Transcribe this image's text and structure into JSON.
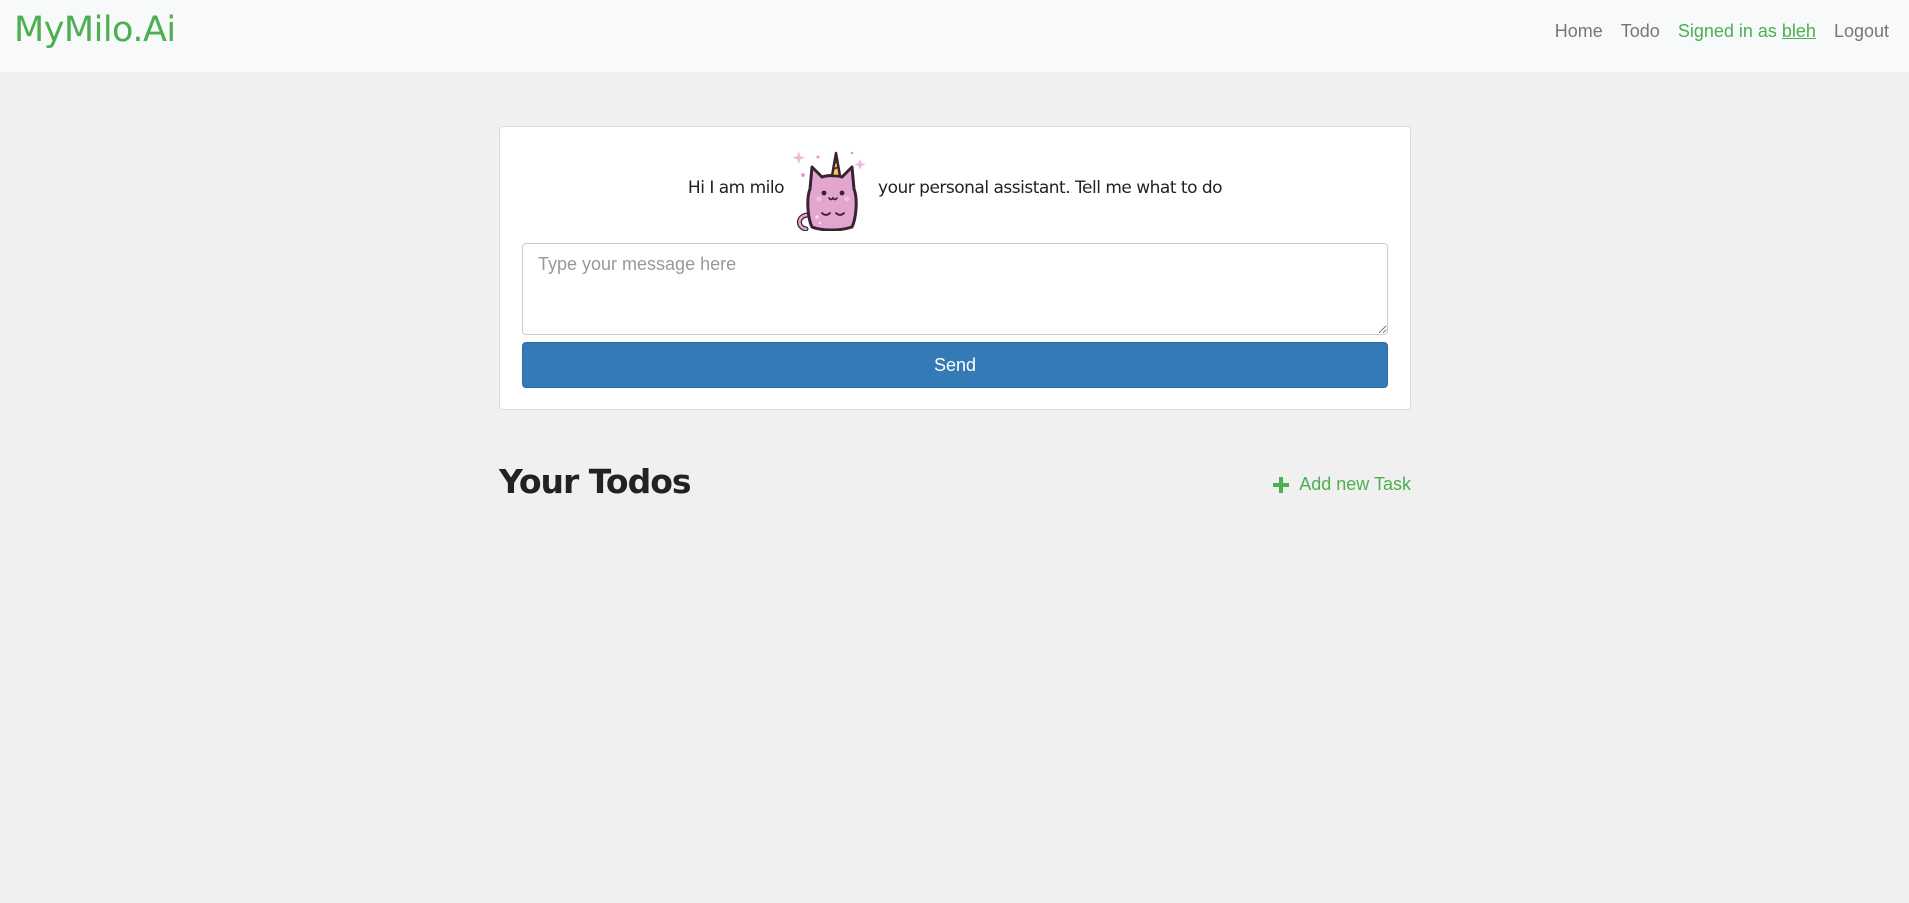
{
  "navbar": {
    "brand": "MyMilo.Ai",
    "links": {
      "home": "Home",
      "todo": "Todo",
      "signed_in_prefix": "Signed in as",
      "username": "bleh",
      "logout": "Logout"
    }
  },
  "chat": {
    "intro_before": "Hi I am milo",
    "intro_after": "your personal assistant. Tell me what to do",
    "mascot_icon": "unicorn-cat-icon",
    "placeholder": "Type your message here",
    "value": "",
    "send_label": "Send"
  },
  "todos": {
    "title": "Your Todos",
    "add_label": "Add new Task",
    "add_icon": "plus-icon",
    "items": []
  },
  "colors": {
    "brand": "#4caf50",
    "primary": "#337ab7",
    "nav_link": "#777777",
    "background": "#f0f0f0"
  }
}
